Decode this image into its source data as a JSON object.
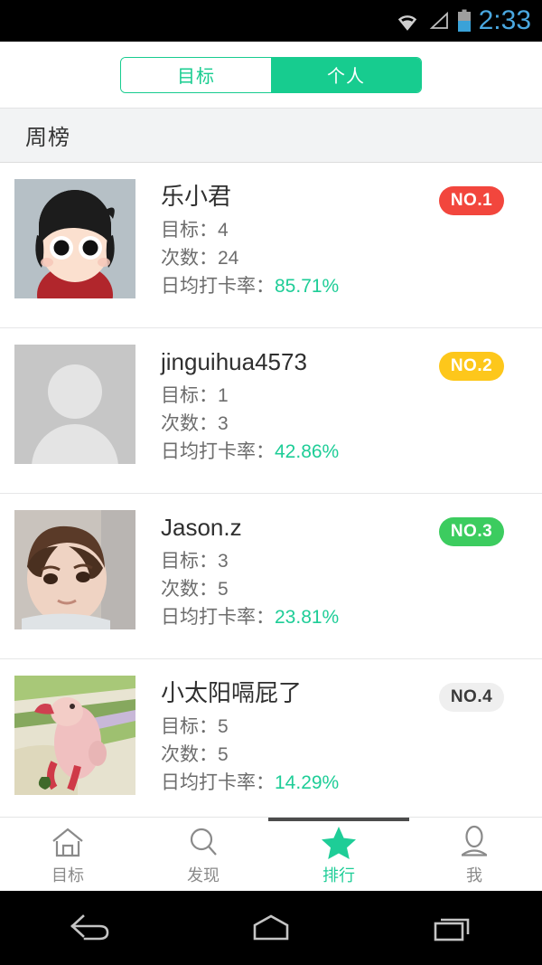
{
  "statusbar": {
    "clock": "2:33",
    "icons": [
      "wifi-icon",
      "signal-icon",
      "battery-icon"
    ],
    "clock_color": "#4aa8e0"
  },
  "tabs": {
    "items": [
      {
        "label": "目标",
        "active": false
      },
      {
        "label": "个人",
        "active": true
      }
    ],
    "accent_color": "#17cc8f"
  },
  "section": {
    "title": "周榜"
  },
  "labels": {
    "goal": "目标：",
    "count": "次数：",
    "rate": "日均打卡率："
  },
  "rank_list": [
    {
      "name": "乐小君",
      "goal": "4",
      "count": "24",
      "rate": "85.71%",
      "badge": "NO.1",
      "badge_bg": "#f2463d",
      "badge_fg": "#ffffff",
      "avatar": "cartoon-boy-avatar"
    },
    {
      "name": "jinguihua4573",
      "goal": "1",
      "count": "3",
      "rate": "42.86%",
      "badge": "NO.2",
      "badge_bg": "#fdc71b",
      "badge_fg": "#ffffff",
      "avatar": "default-person-avatar"
    },
    {
      "name": "Jason.z",
      "goal": "3",
      "count": "5",
      "rate": "23.81%",
      "badge": "NO.3",
      "badge_bg": "#3ccc5f",
      "badge_fg": "#ffffff",
      "avatar": "toddler-photo-avatar"
    },
    {
      "name": "小太阳嗝屁了",
      "goal": "5",
      "count": "5",
      "rate": "14.29%",
      "badge": "NO.4",
      "badge_bg": "#efefef",
      "badge_fg": "#3a3a3a",
      "avatar": "flamingo-plush-avatar"
    }
  ],
  "bottom_nav": {
    "items": [
      {
        "label": "目标",
        "icon": "home-icon",
        "active": false
      },
      {
        "label": "发现",
        "icon": "search-icon",
        "active": false
      },
      {
        "label": "排行",
        "icon": "star-icon",
        "active": true
      },
      {
        "label": "我",
        "icon": "person-icon",
        "active": false
      }
    ],
    "active_color": "#1ecd97"
  },
  "system_nav": {
    "back": "back-icon",
    "home": "home-icon",
    "recents": "recents-icon"
  },
  "accent": {
    "rate_color": "#1ecd97",
    "green": "#17cc8f"
  }
}
